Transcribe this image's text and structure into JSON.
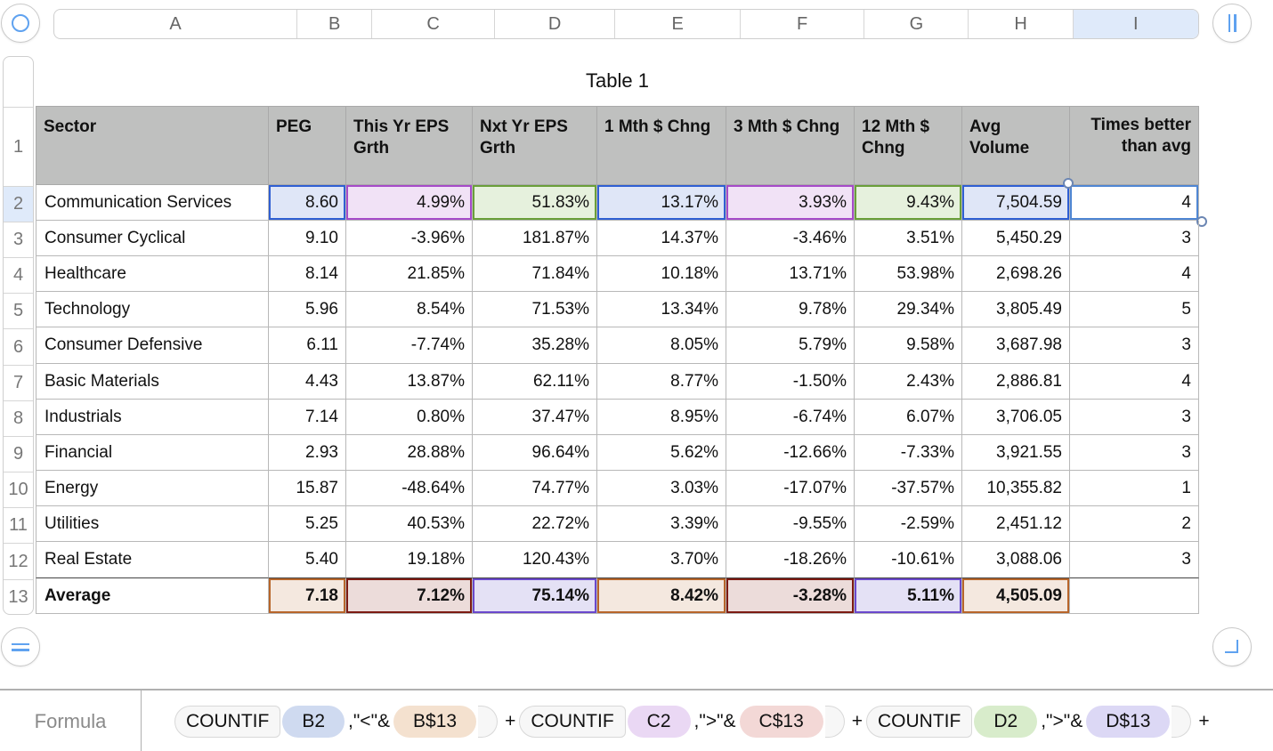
{
  "column_headers": [
    {
      "label": "A",
      "selected": false
    },
    {
      "label": "B",
      "selected": false
    },
    {
      "label": "C",
      "selected": false
    },
    {
      "label": "D",
      "selected": false
    },
    {
      "label": "E",
      "selected": false
    },
    {
      "label": "F",
      "selected": false
    },
    {
      "label": "G",
      "selected": false
    },
    {
      "label": "H",
      "selected": false
    },
    {
      "label": "I",
      "selected": true
    }
  ],
  "row_headers": [
    "1",
    "2",
    "3",
    "4",
    "5",
    "6",
    "7",
    "8",
    "9",
    "10",
    "11",
    "12",
    "13"
  ],
  "selected_row": "2",
  "table": {
    "title": "Table 1",
    "headers": [
      "Sector",
      "PEG",
      "This Yr EPS Grth",
      "Nxt Yr EPS Grth",
      "1 Mth $ Chng",
      "3 Mth $ Chng",
      "12 Mth $ Chng",
      "Avg Volume",
      "Times better than avg"
    ],
    "rows": [
      [
        "Communication Services",
        "8.60",
        "4.99%",
        "51.83%",
        "13.17%",
        "3.93%",
        "9.43%",
        "7,504.59",
        "4"
      ],
      [
        "Consumer Cyclical",
        "9.10",
        "-3.96%",
        "181.87%",
        "14.37%",
        "-3.46%",
        "3.51%",
        "5,450.29",
        "3"
      ],
      [
        "Healthcare",
        "8.14",
        "21.85%",
        "71.84%",
        "10.18%",
        "13.71%",
        "53.98%",
        "2,698.26",
        "4"
      ],
      [
        "Technology",
        "5.96",
        "8.54%",
        "71.53%",
        "13.34%",
        "9.78%",
        "29.34%",
        "3,805.49",
        "5"
      ],
      [
        "Consumer Defensive",
        "6.11",
        "-7.74%",
        "35.28%",
        "8.05%",
        "5.79%",
        "9.58%",
        "3,687.98",
        "3"
      ],
      [
        "Basic Materials",
        "4.43",
        "13.87%",
        "62.11%",
        "8.77%",
        "-1.50%",
        "2.43%",
        "2,886.81",
        "4"
      ],
      [
        "Industrials",
        "7.14",
        "0.80%",
        "37.47%",
        "8.95%",
        "-6.74%",
        "6.07%",
        "3,706.05",
        "3"
      ],
      [
        "Financial",
        "2.93",
        "28.88%",
        "96.64%",
        "5.62%",
        "-12.66%",
        "-7.33%",
        "3,921.55",
        "3"
      ],
      [
        "Energy",
        "15.87",
        "-48.64%",
        "74.77%",
        "3.03%",
        "-17.07%",
        "-37.57%",
        "10,355.82",
        "1"
      ],
      [
        "Utilities",
        "5.25",
        "40.53%",
        "22.72%",
        "3.39%",
        "-9.55%",
        "-2.59%",
        "2,451.12",
        "2"
      ],
      [
        "Real Estate",
        "5.40",
        "19.18%",
        "120.43%",
        "3.70%",
        "-18.26%",
        "-10.61%",
        "3,088.06",
        "3"
      ]
    ],
    "average_row": [
      "Average",
      "7.18",
      "7.12%",
      "75.14%",
      "8.42%",
      "-3.28%",
      "5.11%",
      "4,505.09",
      ""
    ],
    "selected_cell": "I2"
  },
  "formula_bar": {
    "label": "Formula",
    "tokens": [
      {
        "type": "fn",
        "text": "COUNTIF"
      },
      {
        "type": "ref",
        "text": "B2",
        "color": "#cfdaf0"
      },
      {
        "type": "lit",
        "text": ",\"<\"&"
      },
      {
        "type": "ref",
        "text": "B$13",
        "color": "#f4e1cf"
      },
      {
        "type": "close"
      },
      {
        "type": "op",
        "text": "+"
      },
      {
        "type": "fn",
        "text": "COUNTIF"
      },
      {
        "type": "ref",
        "text": "C2",
        "color": "#ead8f4"
      },
      {
        "type": "lit",
        "text": ",\">\"&"
      },
      {
        "type": "ref",
        "text": "C$13",
        "color": "#f3d8d6"
      },
      {
        "type": "close"
      },
      {
        "type": "op",
        "text": "+"
      },
      {
        "type": "fn",
        "text": "COUNTIF"
      },
      {
        "type": "ref",
        "text": "D2",
        "color": "#d8eccb"
      },
      {
        "type": "lit",
        "text": ",\">\"&"
      },
      {
        "type": "ref",
        "text": "D$13",
        "color": "#dcd8f5"
      },
      {
        "type": "close"
      },
      {
        "type": "op",
        "text": "+"
      }
    ]
  },
  "icons": {
    "select_all": "circle-select-icon",
    "add_column": "add-column-icon",
    "add_row": "add-row-icon",
    "resize_table": "resize-corner-icon"
  }
}
